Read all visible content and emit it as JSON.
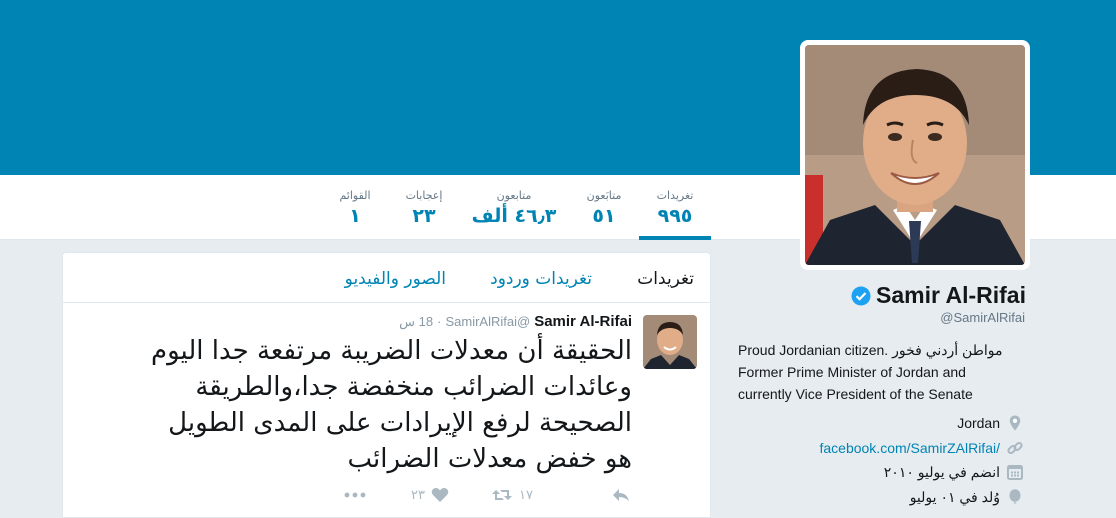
{
  "colors": {
    "brand": "#0084b4",
    "banner": "#0084b4",
    "verified": "#1da1f2"
  },
  "stats": [
    {
      "label": "تغريدات",
      "value": "٩٩٥",
      "active": true
    },
    {
      "label": "متابَعون",
      "value": "٥١"
    },
    {
      "label": "متابعون",
      "value": "٤٦٫٣ ألف"
    },
    {
      "label": "إعجابات",
      "value": "٢٣"
    },
    {
      "label": "القوائم",
      "value": "١"
    }
  ],
  "profile": {
    "name": "Samir Al-Rifai",
    "handle": "@SamirAlRifai",
    "bio_line1": "Proud Jordanian citizen. مواطن أردني فخور",
    "bio_line2": "Former Prime Minister of Jordan and",
    "bio_line3": "currently Vice President of the Senate",
    "location": "Jordan",
    "link": "facebook.com/SamirZAlRifai/",
    "joined": "انضم في يوليو ٢٠١٠",
    "born": "وُلد في ٠١ يوليو",
    "icons": {
      "verified": "verified-badge-icon",
      "location": "location-pin-icon",
      "link": "link-icon",
      "joined": "calendar-icon",
      "born": "balloon-icon"
    }
  },
  "tabs": [
    {
      "label": "تغريدات",
      "active": true
    },
    {
      "label": "تغريدات وردود"
    },
    {
      "label": "الصور والفيديو"
    }
  ],
  "tweet": {
    "name": "Samir Al-Rifai",
    "handle": "@SamirAlRifai",
    "dot": "·",
    "time": "18 س",
    "text_line1": "الحقيقة أن معدلات الضريبة مرتفعة جدا اليوم",
    "text_line2": "وعائدات الضرائب منخفضة جدا،والطريقة",
    "text_line3": "الصحيحة لرفع الإيرادات على المدى الطويل",
    "text_line4": "هو خفض معدلات الضرائب",
    "retweets": "١٧",
    "likes": "٢٣",
    "icons": {
      "reply": "reply-icon",
      "retweet": "retweet-icon",
      "like": "heart-icon",
      "more": "more-icon"
    }
  }
}
